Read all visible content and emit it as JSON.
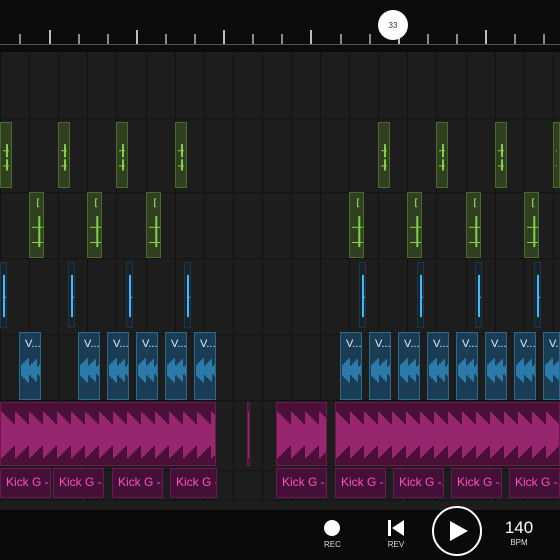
{
  "timeline": {
    "playhead_bar": "33",
    "bar_ticks": [
      2,
      5,
      8,
      11,
      14,
      17,
      20,
      23,
      26,
      29,
      32,
      35,
      38,
      41,
      44,
      47,
      50,
      53,
      56,
      59
    ],
    "accent_ticks": [
      5,
      14,
      23,
      32,
      41,
      50,
      59
    ]
  },
  "tracks": [
    {
      "id": "hat",
      "color": "#7fd24a",
      "clip_label": "",
      "clips": [
        {
          "bar": 0,
          "len": 1.2
        },
        {
          "bar": 6,
          "len": 1.2
        },
        {
          "bar": 12,
          "len": 1.2
        },
        {
          "bar": 18,
          "len": 1.2
        },
        {
          "bar": 39,
          "len": 1.2
        },
        {
          "bar": 45,
          "len": 1.2
        },
        {
          "bar": 51,
          "len": 1.2
        },
        {
          "bar": 57,
          "len": 1.2
        }
      ]
    },
    {
      "id": "snare",
      "color": "#7fd24a",
      "clip_label": "[...",
      "clips": [
        {
          "bar": 3,
          "len": 1.5
        },
        {
          "bar": 9,
          "len": 1.5
        },
        {
          "bar": 15,
          "len": 1.5
        },
        {
          "bar": 36,
          "len": 1.5
        },
        {
          "bar": 42,
          "len": 1.5
        },
        {
          "bar": 48,
          "len": 1.5
        },
        {
          "bar": 54,
          "len": 1.5
        }
      ]
    },
    {
      "id": "perc",
      "color": "#3fb8ff",
      "clip_label": "",
      "clips": [
        {
          "bar": 0,
          "len": 0.7
        },
        {
          "bar": 7,
          "len": 0.7
        },
        {
          "bar": 13,
          "len": 0.7
        },
        {
          "bar": 19,
          "len": 0.7
        },
        {
          "bar": 37,
          "len": 0.7
        },
        {
          "bar": 43,
          "len": 0.7
        },
        {
          "bar": 49,
          "len": 0.7
        },
        {
          "bar": 55,
          "len": 0.7
        }
      ]
    },
    {
      "id": "vox",
      "color": "#3fb8ff",
      "clip_label": "V...",
      "clips": [
        {
          "bar": 2,
          "len": 2.3
        },
        {
          "bar": 8,
          "len": 2.3
        },
        {
          "bar": 11,
          "len": 2.3
        },
        {
          "bar": 14,
          "len": 2.3
        },
        {
          "bar": 17,
          "len": 2.3
        },
        {
          "bar": 20,
          "len": 2.3
        },
        {
          "bar": 35,
          "len": 2.3
        },
        {
          "bar": 38,
          "len": 2.3
        },
        {
          "bar": 41,
          "len": 2.3
        },
        {
          "bar": 44,
          "len": 2.3
        },
        {
          "bar": 47,
          "len": 2.3
        },
        {
          "bar": 50,
          "len": 2.3
        },
        {
          "bar": 53,
          "len": 2.3
        },
        {
          "bar": 56,
          "len": 2.3
        }
      ]
    },
    {
      "id": "bass",
      "color": "#e0339a",
      "clip_label": "",
      "clips": [
        {
          "bar": 0,
          "len": 22.3
        },
        {
          "bar": 25.5,
          "len": 0.3
        },
        {
          "bar": 28.5,
          "len": 5.3
        },
        {
          "bar": 34.5,
          "len": 25.5
        }
      ]
    },
    {
      "id": "kick",
      "color": "#e0339a",
      "clip_label": "Kick G -...",
      "clips": [
        {
          "bar": 0,
          "len": 5.3
        },
        {
          "bar": 5.5,
          "len": 5.3
        },
        {
          "bar": 11.5,
          "len": 5.3
        },
        {
          "bar": 17.5,
          "len": 4.8
        },
        {
          "bar": 28.5,
          "len": 5.3
        },
        {
          "bar": 34.5,
          "len": 5.3
        },
        {
          "bar": 40.5,
          "len": 5.3
        },
        {
          "bar": 46.5,
          "len": 5.3
        },
        {
          "bar": 52.5,
          "len": 5.3
        }
      ]
    }
  ],
  "transport": {
    "rec_label": "REC",
    "rev_label": "REV",
    "bpm_value": "140",
    "bpm_label": "BPM"
  }
}
